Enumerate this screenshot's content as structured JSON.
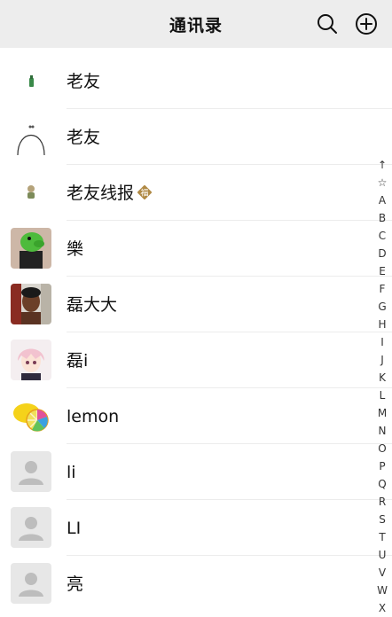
{
  "header": {
    "title": "通讯录"
  },
  "contacts": [
    {
      "name": "老友",
      "avatar": "small-bottle-icon"
    },
    {
      "name": "老友",
      "avatar": "arc-drawing"
    },
    {
      "name": "老友线报",
      "avatar": "small-figure-icon",
      "badge": "福"
    },
    {
      "name": "樂",
      "avatar": "green-dinosaur-costume-photo"
    },
    {
      "name": "磊大大",
      "avatar": "person-photo"
    },
    {
      "name": "磊i",
      "avatar": "anime-character"
    },
    {
      "name": "lemon",
      "avatar": "lemon-slices"
    },
    {
      "name": "li",
      "avatar": "default-user-icon"
    },
    {
      "name": "LI",
      "avatar": "default-user-icon"
    },
    {
      "name": "亮",
      "avatar": "default-user-icon"
    }
  ],
  "index_bar": [
    "↑",
    "☆",
    "A",
    "B",
    "C",
    "D",
    "E",
    "F",
    "G",
    "H",
    "I",
    "J",
    "K",
    "L",
    "M",
    "N",
    "O",
    "P",
    "Q",
    "R",
    "S",
    "T",
    "U",
    "V",
    "W",
    "X"
  ]
}
